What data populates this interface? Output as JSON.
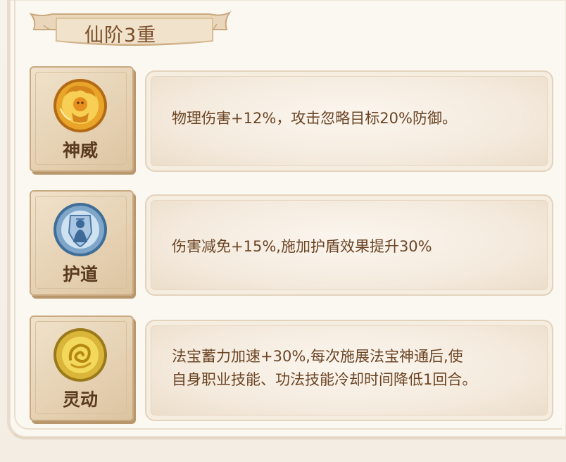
{
  "title": "仙阶3重",
  "skills": [
    {
      "name": "神威",
      "icon": "golden-dragon-emblem-icon",
      "lines": [
        "物理伤害+12%，攻击忽略目标20%防御。"
      ],
      "emblem_colors": {
        "outer": "#e9a52a",
        "inner": "#f4c542",
        "figure": "#d4861c"
      }
    },
    {
      "name": "护道",
      "icon": "blue-shield-guardian-icon",
      "lines": [
        "伤害减免+15%,施加护盾效果提升30%"
      ],
      "emblem_colors": {
        "outer": "#7fa6c9",
        "inner": "#bcd6ec",
        "figure": "#4f7aa8"
      }
    },
    {
      "name": "灵动",
      "icon": "golden-swirl-orb-icon",
      "lines": [
        "法宝蓄力加速+30%,每次施展法宝神通后,使",
        "自身职业技能、功法技能冷却时间降低1回合。"
      ],
      "emblem_colors": {
        "outer": "#d9b53a",
        "inner": "#f2d85c",
        "figure": "#c5961a"
      }
    }
  ],
  "colors": {
    "title_text": "#7a4e2a",
    "label_text": "#5a3b1f",
    "desc_text": "#6b4424",
    "card_border": "#c9aa82"
  }
}
